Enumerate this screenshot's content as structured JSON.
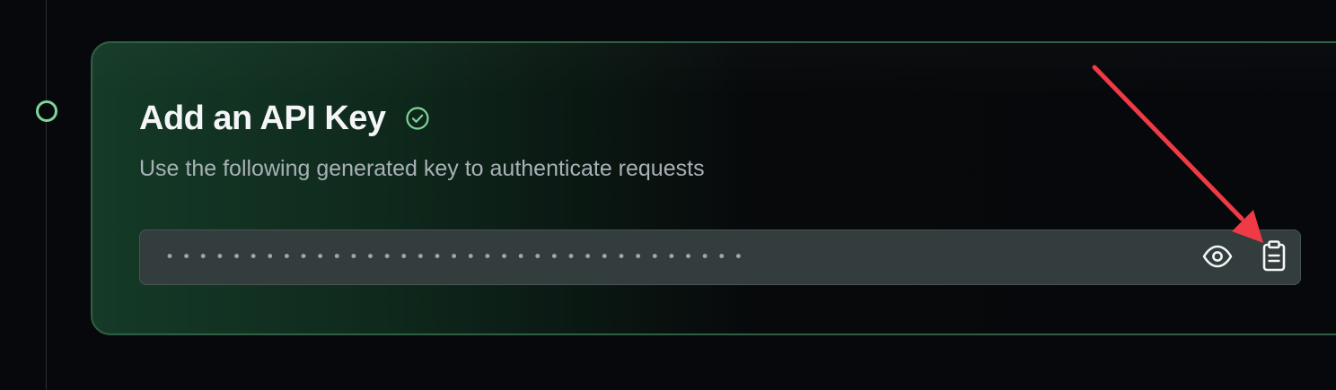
{
  "step": {
    "title": "Add an API Key",
    "status_icon": "check-circle-icon",
    "description": "Use the following generated key to authenticate requests",
    "api_key": {
      "masked_value": "•••••••••••••••••••••••••••••••••••",
      "reveal_icon": "eye-icon",
      "copy_icon": "clipboard-icon"
    }
  },
  "colors": {
    "background": "#07080c",
    "accent_green": "#7fd49a",
    "card_border": "#2f5f42",
    "field_background": "#333d3d",
    "annotation_arrow": "#f03a45"
  }
}
